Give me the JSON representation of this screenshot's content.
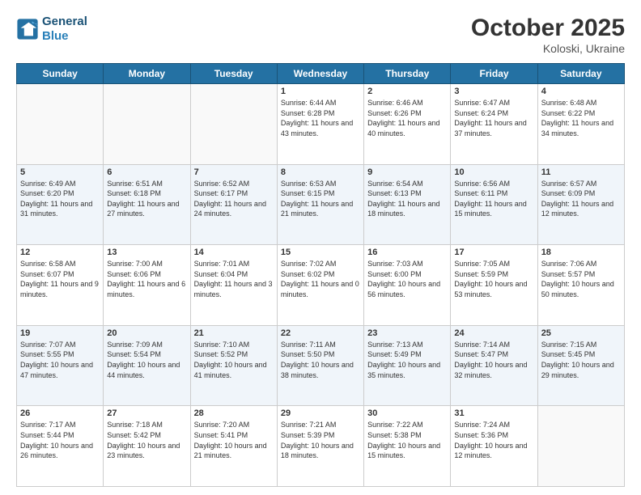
{
  "logo": {
    "line1": "General",
    "line2": "Blue"
  },
  "header": {
    "month": "October 2025",
    "location": "Koloski, Ukraine"
  },
  "weekdays": [
    "Sunday",
    "Monday",
    "Tuesday",
    "Wednesday",
    "Thursday",
    "Friday",
    "Saturday"
  ],
  "weeks": [
    [
      {
        "day": "",
        "info": ""
      },
      {
        "day": "",
        "info": ""
      },
      {
        "day": "",
        "info": ""
      },
      {
        "day": "1",
        "info": "Sunrise: 6:44 AM\nSunset: 6:28 PM\nDaylight: 11 hours and 43 minutes."
      },
      {
        "day": "2",
        "info": "Sunrise: 6:46 AM\nSunset: 6:26 PM\nDaylight: 11 hours and 40 minutes."
      },
      {
        "day": "3",
        "info": "Sunrise: 6:47 AM\nSunset: 6:24 PM\nDaylight: 11 hours and 37 minutes."
      },
      {
        "day": "4",
        "info": "Sunrise: 6:48 AM\nSunset: 6:22 PM\nDaylight: 11 hours and 34 minutes."
      }
    ],
    [
      {
        "day": "5",
        "info": "Sunrise: 6:49 AM\nSunset: 6:20 PM\nDaylight: 11 hours and 31 minutes."
      },
      {
        "day": "6",
        "info": "Sunrise: 6:51 AM\nSunset: 6:18 PM\nDaylight: 11 hours and 27 minutes."
      },
      {
        "day": "7",
        "info": "Sunrise: 6:52 AM\nSunset: 6:17 PM\nDaylight: 11 hours and 24 minutes."
      },
      {
        "day": "8",
        "info": "Sunrise: 6:53 AM\nSunset: 6:15 PM\nDaylight: 11 hours and 21 minutes."
      },
      {
        "day": "9",
        "info": "Sunrise: 6:54 AM\nSunset: 6:13 PM\nDaylight: 11 hours and 18 minutes."
      },
      {
        "day": "10",
        "info": "Sunrise: 6:56 AM\nSunset: 6:11 PM\nDaylight: 11 hours and 15 minutes."
      },
      {
        "day": "11",
        "info": "Sunrise: 6:57 AM\nSunset: 6:09 PM\nDaylight: 11 hours and 12 minutes."
      }
    ],
    [
      {
        "day": "12",
        "info": "Sunrise: 6:58 AM\nSunset: 6:07 PM\nDaylight: 11 hours and 9 minutes."
      },
      {
        "day": "13",
        "info": "Sunrise: 7:00 AM\nSunset: 6:06 PM\nDaylight: 11 hours and 6 minutes."
      },
      {
        "day": "14",
        "info": "Sunrise: 7:01 AM\nSunset: 6:04 PM\nDaylight: 11 hours and 3 minutes."
      },
      {
        "day": "15",
        "info": "Sunrise: 7:02 AM\nSunset: 6:02 PM\nDaylight: 11 hours and 0 minutes."
      },
      {
        "day": "16",
        "info": "Sunrise: 7:03 AM\nSunset: 6:00 PM\nDaylight: 10 hours and 56 minutes."
      },
      {
        "day": "17",
        "info": "Sunrise: 7:05 AM\nSunset: 5:59 PM\nDaylight: 10 hours and 53 minutes."
      },
      {
        "day": "18",
        "info": "Sunrise: 7:06 AM\nSunset: 5:57 PM\nDaylight: 10 hours and 50 minutes."
      }
    ],
    [
      {
        "day": "19",
        "info": "Sunrise: 7:07 AM\nSunset: 5:55 PM\nDaylight: 10 hours and 47 minutes."
      },
      {
        "day": "20",
        "info": "Sunrise: 7:09 AM\nSunset: 5:54 PM\nDaylight: 10 hours and 44 minutes."
      },
      {
        "day": "21",
        "info": "Sunrise: 7:10 AM\nSunset: 5:52 PM\nDaylight: 10 hours and 41 minutes."
      },
      {
        "day": "22",
        "info": "Sunrise: 7:11 AM\nSunset: 5:50 PM\nDaylight: 10 hours and 38 minutes."
      },
      {
        "day": "23",
        "info": "Sunrise: 7:13 AM\nSunset: 5:49 PM\nDaylight: 10 hours and 35 minutes."
      },
      {
        "day": "24",
        "info": "Sunrise: 7:14 AM\nSunset: 5:47 PM\nDaylight: 10 hours and 32 minutes."
      },
      {
        "day": "25",
        "info": "Sunrise: 7:15 AM\nSunset: 5:45 PM\nDaylight: 10 hours and 29 minutes."
      }
    ],
    [
      {
        "day": "26",
        "info": "Sunrise: 7:17 AM\nSunset: 5:44 PM\nDaylight: 10 hours and 26 minutes."
      },
      {
        "day": "27",
        "info": "Sunrise: 7:18 AM\nSunset: 5:42 PM\nDaylight: 10 hours and 23 minutes."
      },
      {
        "day": "28",
        "info": "Sunrise: 7:20 AM\nSunset: 5:41 PM\nDaylight: 10 hours and 21 minutes."
      },
      {
        "day": "29",
        "info": "Sunrise: 7:21 AM\nSunset: 5:39 PM\nDaylight: 10 hours and 18 minutes."
      },
      {
        "day": "30",
        "info": "Sunrise: 7:22 AM\nSunset: 5:38 PM\nDaylight: 10 hours and 15 minutes."
      },
      {
        "day": "31",
        "info": "Sunrise: 7:24 AM\nSunset: 5:36 PM\nDaylight: 10 hours and 12 minutes."
      },
      {
        "day": "",
        "info": ""
      }
    ]
  ]
}
